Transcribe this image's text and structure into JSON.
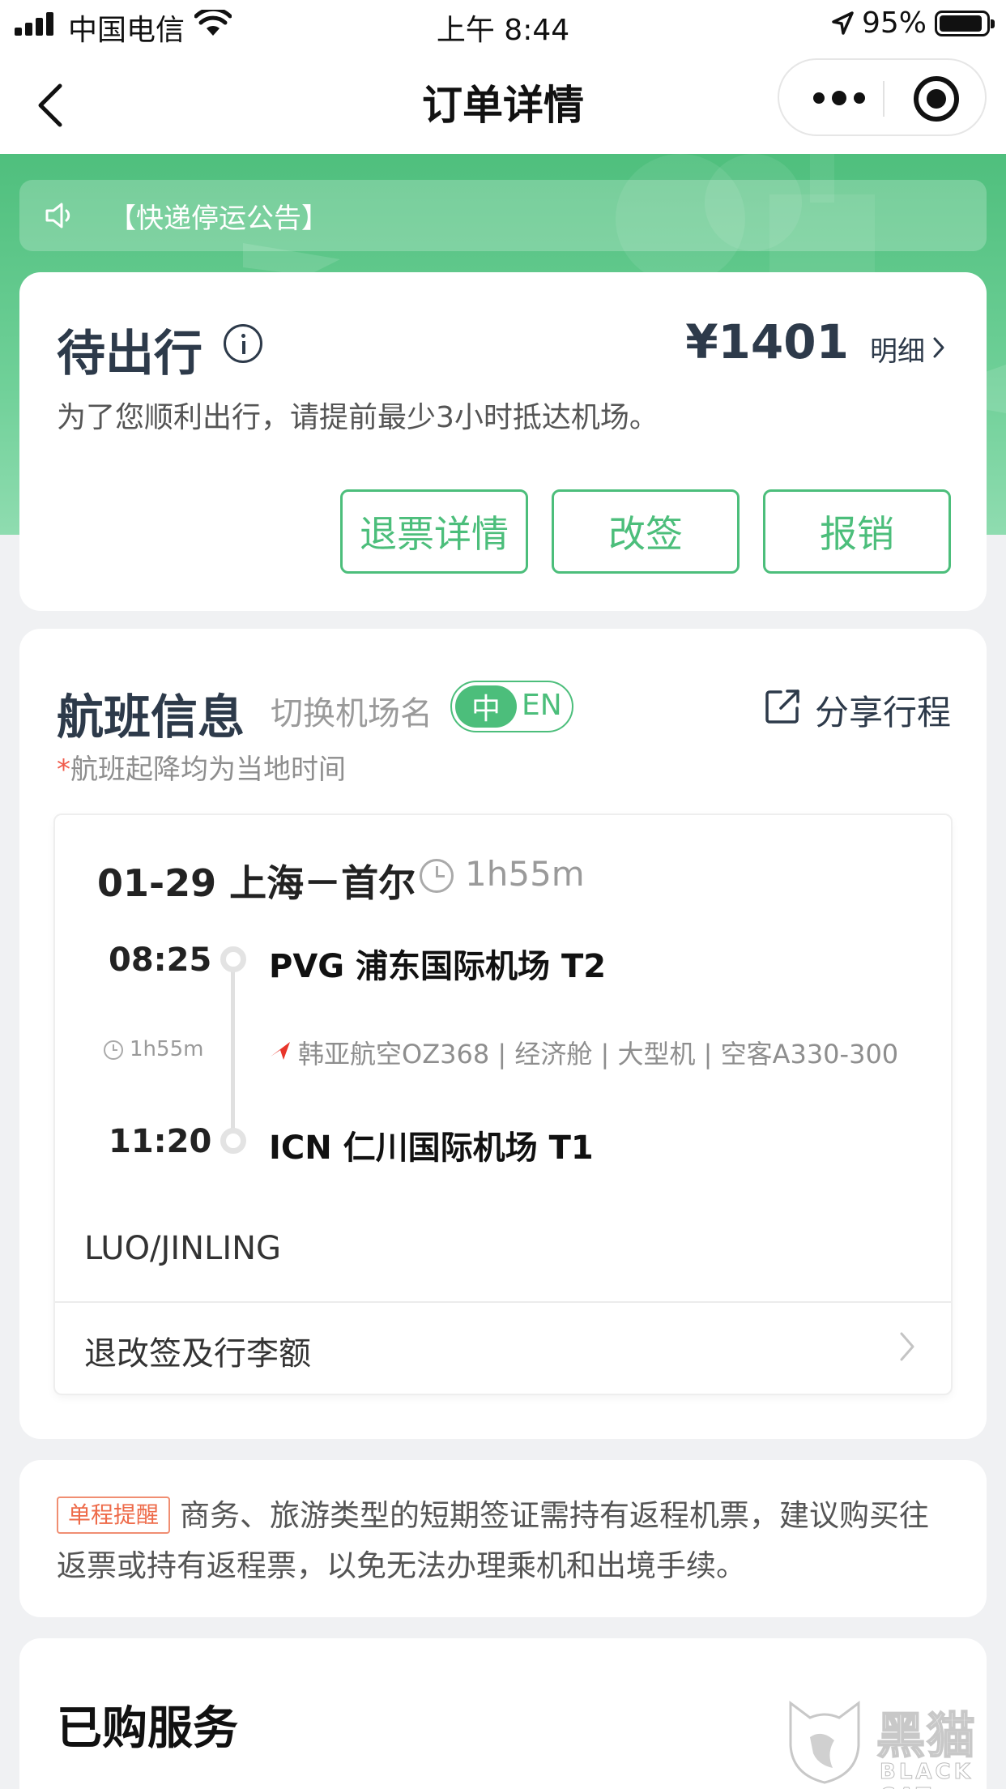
{
  "status_bar": {
    "carrier": "中国电信",
    "time": "上午 8:44",
    "battery": "95%"
  },
  "nav": {
    "title": "订单详情"
  },
  "notice": {
    "text": "【快递停运公告】"
  },
  "order_status": {
    "title": "待出行",
    "price": "¥1401",
    "detail_label": "明细",
    "note": "为了您顺利出行，请提前最少3小时抵达机场。",
    "buttons": {
      "refund": "退票详情",
      "change": "改签",
      "reimburse": "报销"
    }
  },
  "flight": {
    "section_title": "航班信息",
    "switch_label": "切换机场名",
    "toggle_zh": "中",
    "toggle_en": "EN",
    "share_label": "分享行程",
    "note_star": "*",
    "note": "航班起降均为当地时间",
    "segment": {
      "route": "01-29 上海－首尔",
      "duration": "1h55m",
      "departure_time": "08:25",
      "departure_airport": "PVG 浦东国际机场 T2",
      "mid_duration": "1h55m",
      "flight_meta": "韩亚航空OZ368 | 经济舱 | 大型机 | 空客A330-300",
      "arrival_time": "11:20",
      "arrival_airport": "ICN 仁川国际机场 T1",
      "passenger": "LUO/JINLING",
      "baggage_label": "退改签及行李额"
    }
  },
  "reminder": {
    "badge": "单程提醒",
    "text": "商务、旅游类型的短期签证需持有返程机票，建议购买往返票或持有返程票，以免无法办理乘机和出境手续。"
  },
  "services": {
    "title": "已购服务"
  },
  "watermark": {
    "cn": "黑猫",
    "en": "BLACK CAT"
  },
  "colors": {
    "brand_green": "#4cbe7b",
    "title_navy": "#2d3a4a",
    "reminder_orange": "#ee6b4a",
    "airline_red": "#e8352a"
  },
  "icons": [
    "signal-icon",
    "wifi-icon",
    "location-arrow-icon",
    "battery-icon",
    "back-icon",
    "more-icon",
    "target-icon",
    "speaker-icon",
    "info-icon",
    "chevron-right-icon",
    "share-icon",
    "clock-icon",
    "airline-logo-icon"
  ]
}
